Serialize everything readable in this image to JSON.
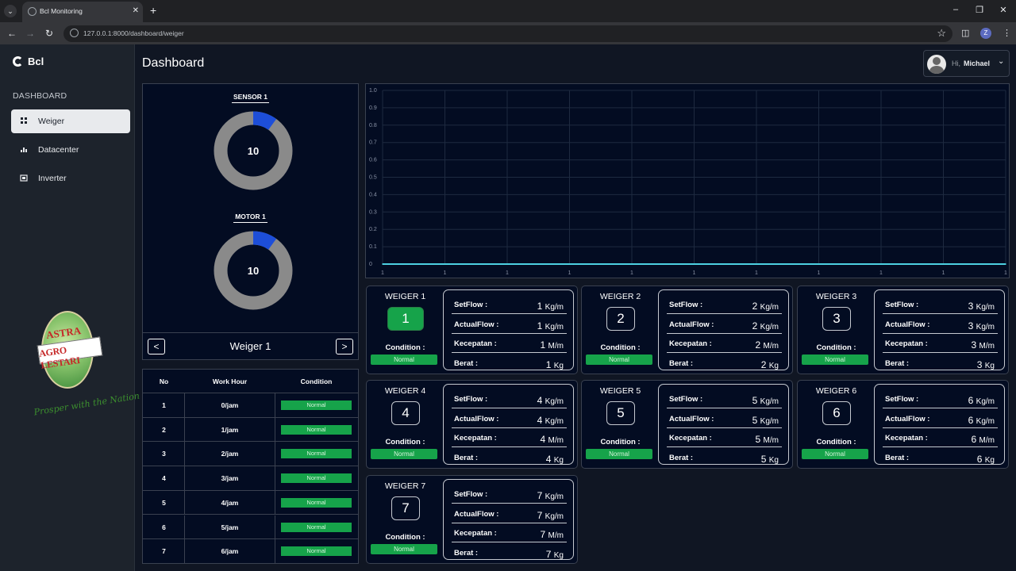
{
  "browser": {
    "tab_title": "Bcl Monitoring",
    "url": "127.0.0.1:8000/dashboard/weiger",
    "profile_initial": "Z"
  },
  "sidebar": {
    "brand": "Bcl",
    "section": "DASHBOARD",
    "items": [
      {
        "label": "Weiger",
        "icon": "grid-icon",
        "active": true
      },
      {
        "label": "Datacenter",
        "icon": "bar-chart-icon",
        "active": false
      },
      {
        "label": "Inverter",
        "icon": "inverter-icon",
        "active": false
      }
    ],
    "logo": {
      "line1": "ASTRA",
      "line2": "AGRO LESTARI",
      "tagline": "Prosper with the Nation"
    }
  },
  "header": {
    "title": "Dashboard",
    "greeting": "Hi,",
    "user": "Michael"
  },
  "gauges": [
    {
      "title": "SENSOR 1",
      "value": "10",
      "fraction": 0.1
    },
    {
      "title": "MOTOR 1",
      "value": "10",
      "fraction": 0.1
    }
  ],
  "gauge_nav": {
    "label": "Weiger 1",
    "prev": "<",
    "next": ">"
  },
  "work_table": {
    "headers": [
      "No",
      "Work Hour",
      "Condition"
    ],
    "rows": [
      {
        "no": "1",
        "hour": "0/jam",
        "condition": "Normal"
      },
      {
        "no": "2",
        "hour": "1/jam",
        "condition": "Normal"
      },
      {
        "no": "3",
        "hour": "2/jam",
        "condition": "Normal"
      },
      {
        "no": "4",
        "hour": "3/jam",
        "condition": "Normal"
      },
      {
        "no": "5",
        "hour": "4/jam",
        "condition": "Normal"
      },
      {
        "no": "6",
        "hour": "5/jam",
        "condition": "Normal"
      },
      {
        "no": "7",
        "hour": "6/jam",
        "condition": "Normal"
      }
    ]
  },
  "chart_data": {
    "type": "line",
    "x": [
      "1",
      "1",
      "1",
      "1",
      "1",
      "1",
      "1",
      "1",
      "1",
      "1",
      "1"
    ],
    "series": [
      {
        "values": [
          0,
          0,
          0,
          0,
          0,
          0,
          0,
          0,
          0,
          0,
          0
        ],
        "color": "#4dd0e1"
      }
    ],
    "ylim": [
      0,
      1
    ],
    "yticks": [
      "0",
      "0.1",
      "0.2",
      "0.3",
      "0.4",
      "0.5",
      "0.6",
      "0.7",
      "0.8",
      "0.9",
      "1.0"
    ],
    "grid": true
  },
  "weiger_labels": {
    "setflow": "SetFlow :",
    "actualflow": "ActualFlow :",
    "kecepatan": "Kecepatan :",
    "berat": "Berat :",
    "condition": "Condition :"
  },
  "weigers": [
    {
      "name": "WEIGER 1",
      "num": "1",
      "active": true,
      "status": "Normal",
      "setflow": "1",
      "setflow_unit": "Kg/m",
      "actualflow": "1",
      "actualflow_unit": "Kg/m",
      "kecepatan": "1",
      "kecepatan_unit": "M/m",
      "berat": "1",
      "berat_unit": "Kg"
    },
    {
      "name": "WEIGER 2",
      "num": "2",
      "active": false,
      "status": "Normal",
      "setflow": "2",
      "setflow_unit": "Kg/m",
      "actualflow": "2",
      "actualflow_unit": "Kg/m",
      "kecepatan": "2",
      "kecepatan_unit": "M/m",
      "berat": "2",
      "berat_unit": "Kg"
    },
    {
      "name": "WEIGER 3",
      "num": "3",
      "active": false,
      "status": "Normal",
      "setflow": "3",
      "setflow_unit": "Kg/m",
      "actualflow": "3",
      "actualflow_unit": "Kg/m",
      "kecepatan": "3",
      "kecepatan_unit": "M/m",
      "berat": "3",
      "berat_unit": "Kg"
    },
    {
      "name": "WEIGER 4",
      "num": "4",
      "active": false,
      "status": "Normal",
      "setflow": "4",
      "setflow_unit": "Kg/m",
      "actualflow": "4",
      "actualflow_unit": "Kg/m",
      "kecepatan": "4",
      "kecepatan_unit": "M/m",
      "berat": "4",
      "berat_unit": "Kg"
    },
    {
      "name": "WEIGER 5",
      "num": "5",
      "active": false,
      "status": "Normal",
      "setflow": "5",
      "setflow_unit": "Kg/m",
      "actualflow": "5",
      "actualflow_unit": "Kg/m",
      "kecepatan": "5",
      "kecepatan_unit": "M/m",
      "berat": "5",
      "berat_unit": "Kg"
    },
    {
      "name": "WEIGER 6",
      "num": "6",
      "active": false,
      "status": "Normal",
      "setflow": "6",
      "setflow_unit": "Kg/m",
      "actualflow": "6",
      "actualflow_unit": "Kg/m",
      "kecepatan": "6",
      "kecepatan_unit": "M/m",
      "berat": "6",
      "berat_unit": "Kg"
    },
    {
      "name": "WEIGER 7",
      "num": "7",
      "active": false,
      "status": "Normal",
      "setflow": "7",
      "setflow_unit": "Kg/m",
      "actualflow": "7",
      "actualflow_unit": "Kg/m",
      "kecepatan": "7",
      "kecepatan_unit": "M/m",
      "berat": "7",
      "berat_unit": "Kg"
    }
  ]
}
